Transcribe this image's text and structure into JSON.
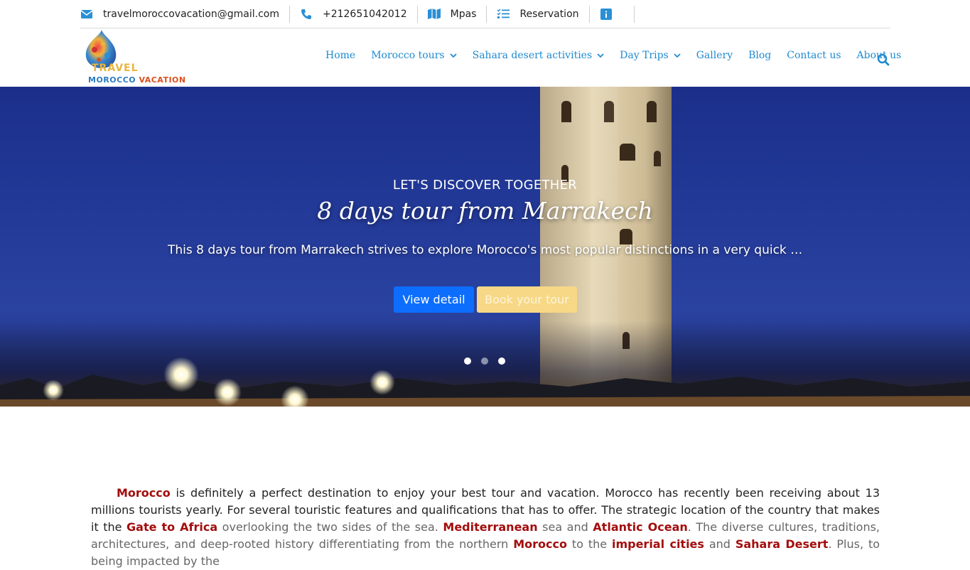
{
  "topbar": {
    "email": "travelmoroccovacation@gmail.com",
    "phone": "+212651042012",
    "maps": "Mpas",
    "reservation": "Reservation",
    "info_icon": "info-icon"
  },
  "logo": {
    "line1": "TRAVEL",
    "line2a": "MOROCCO ",
    "line2b": "VACATION"
  },
  "nav": {
    "items": [
      {
        "label": "Home"
      },
      {
        "label": "Morocco tours"
      },
      {
        "label": "Sahara desert activities"
      },
      {
        "label": "Day Trips"
      },
      {
        "label": "Gallery"
      },
      {
        "label": "Blog"
      },
      {
        "label": "Contact us"
      },
      {
        "label": "About us"
      }
    ]
  },
  "hero": {
    "subtitle": "LET'S DISCOVER TOGETHER",
    "title": "8 days tour from Marrakech",
    "description": "This 8 days tour from Marrakech strives to explore Morocco's most popular distinctions in a very quick and well organized itinerary",
    "view_detail": "View detail",
    "book_tour": "Book your tour",
    "active_slide": 1,
    "slide_count": 3
  },
  "content": {
    "p1": [
      {
        "text": "Morocco",
        "hl": true
      },
      {
        "text": " is definitely a perfect destination to enjoy your best tour and vacation. Morocco has recently been receiving about 13 millions tourists yearly. For several touristic features and qualifications that has to offer. The strategic location of the country that makes it the "
      },
      {
        "text": "Gate to Africa",
        "hl": true
      },
      {
        "text": " overlooking the two sides of the sea. ",
        "faded": true
      },
      {
        "text": "Mediterranean",
        "hl": true
      },
      {
        "text": " sea and ",
        "faded": true
      },
      {
        "text": "Atlantic Ocean",
        "hl": true
      },
      {
        "text": ". The diverse cultures, traditions, architectures, and deep-rooted history differentiating from the northern ",
        "faded": true
      },
      {
        "text": "Morocco",
        "hl": true
      },
      {
        "text": " to the ",
        "faded": true
      },
      {
        "text": "imperial cities",
        "hl": true
      },
      {
        "text": " and ",
        "faded": true
      },
      {
        "text": "Sahara Desert",
        "hl": true
      },
      {
        "text": ". Plus, to being impacted by the",
        "faded": true
      }
    ]
  },
  "colors": {
    "nav_link": "#1f8ad0",
    "highlight": "#a30d0d",
    "btn_primary": "#0d6efd",
    "btn_secondary": "#f7d886"
  }
}
